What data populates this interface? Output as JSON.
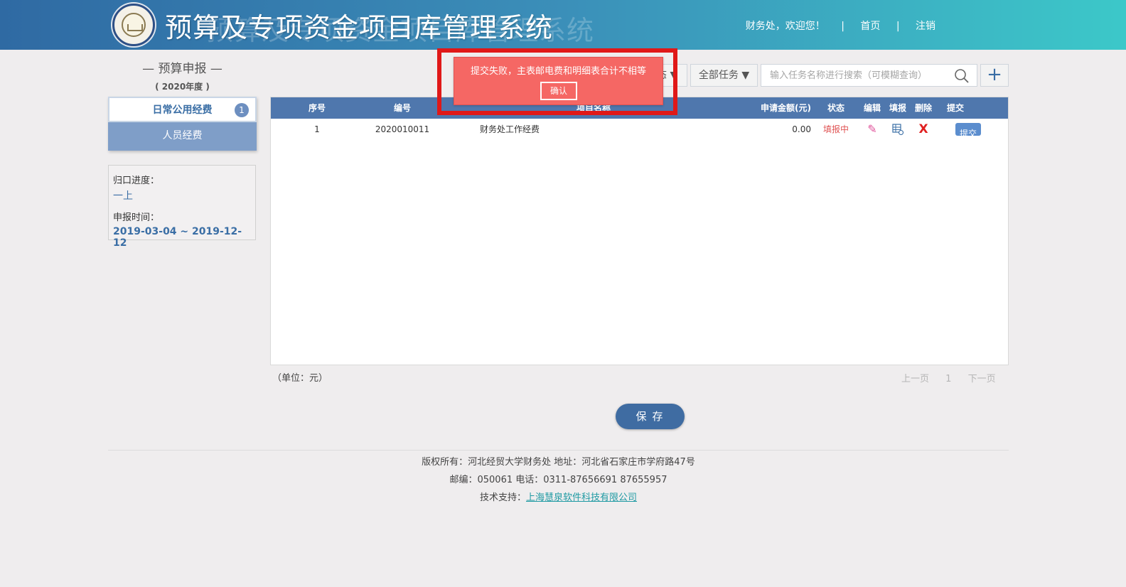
{
  "header": {
    "title": "预算及专项资金项目库管理系统",
    "title_ghost": "预算及专项资金项目库管理系统",
    "welcome": "财务处，欢迎您！",
    "separator": "|",
    "home_link": "首页",
    "logout_link": "注销"
  },
  "left_panel": {
    "title": "— 预算申报 —",
    "year": "( 2020年度 )",
    "categories": [
      {
        "label": "日常公用经费",
        "badge": "1"
      },
      {
        "label": "人员经费"
      }
    ],
    "progress_label": "归口进度：",
    "progress_value": "一上",
    "time_label": "申报时间：",
    "time_value": "2019-03-04 ~ 2019-12-12"
  },
  "toolbar": {
    "filter1_label": "态 ▼",
    "filter2_label": "全部任务 ▼",
    "search_placeholder": "输入任务名称进行搜索（可模糊查询）",
    "add_label": "+"
  },
  "table": {
    "headers": {
      "seq": "序号",
      "code": "编号",
      "name": "项目名称",
      "amount": "申请金额(元)",
      "status": "状态",
      "edit": "编辑",
      "fill": "填报",
      "delete": "删除",
      "submit": "提交"
    },
    "rows": [
      {
        "seq": "1",
        "code": "2020010011",
        "name": "财务处工作经费",
        "amount": "0.00",
        "status": "填报中",
        "edit_icon": "✎",
        "delete_icon": "X",
        "submit_label": "提交"
      }
    ]
  },
  "unit_note": "（单位：元）",
  "pager": {
    "prev": "上一页",
    "page": "1",
    "next": "下一页"
  },
  "save_label": "保存",
  "footer": {
    "line1": "版权所有：河北经贸大学财务处 地址：河北省石家庄市学府路47号",
    "line2": "邮编：050061 电话：0311-87656691 87655957",
    "support_label": "技术支持：",
    "support_link": "上海慧泉软件科技有限公司"
  },
  "alert": {
    "message": "提交失败，主表邮电费和明细表合计不相等",
    "confirm": "确认"
  },
  "colors": {
    "header_start": "#2f6aa3",
    "header_end": "#3cc8c9",
    "table_header": "#4f77ad",
    "alert_bg": "#f56764",
    "highlight": "#e01818",
    "status_filling": "#e05454"
  }
}
